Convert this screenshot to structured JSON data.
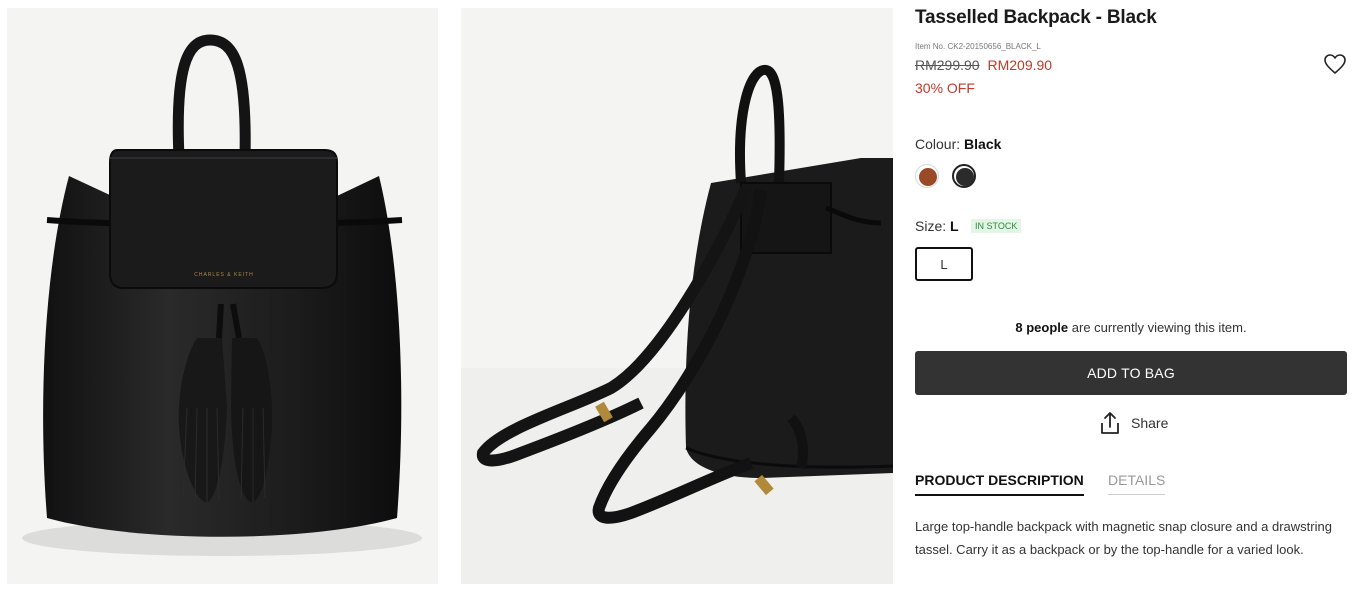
{
  "product": {
    "title": "Tasselled Backpack - Black",
    "item_no": "Item No. CK2-20150656_BLACK_L",
    "price_original": "RM299.90",
    "price_sale": "RM209.90",
    "discount": "30% OFF",
    "brand_mark": "CHARLES & KEITH"
  },
  "colour": {
    "label": "Colour:",
    "selected": "Black",
    "options": [
      {
        "name": "Brown",
        "hex": "#9a4a26"
      },
      {
        "name": "Black",
        "hex": "#2b2b2b"
      }
    ]
  },
  "size": {
    "label": "Size:",
    "selected": "L",
    "stock_status": "IN STOCK",
    "options": [
      "L"
    ]
  },
  "social_proof": {
    "count_text": "8 people",
    "rest_text": "are currently viewing this item."
  },
  "actions": {
    "add_to_bag": "ADD TO BAG",
    "share": "Share"
  },
  "tabs": {
    "description": "PRODUCT DESCRIPTION",
    "details": "DETAILS"
  },
  "description": "Large top-handle backpack with magnetic snap closure and a drawstring tassel. Carry it as a backpack or by the top-handle for a varied look.",
  "icons": {
    "wishlist": "heart-outline-icon",
    "share": "upload-share-icon"
  },
  "colors": {
    "sale_red": "#c0392b",
    "button_dark": "#333333",
    "stock_green": "#2e8b3e"
  }
}
